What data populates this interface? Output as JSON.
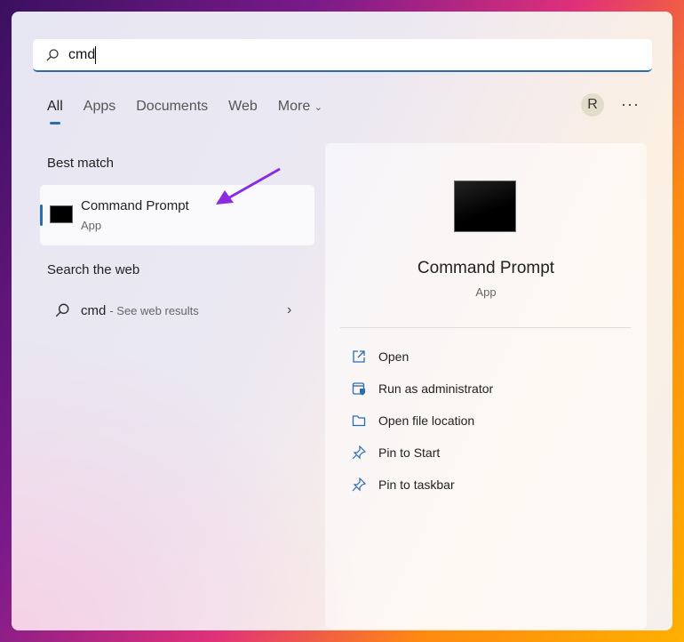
{
  "search": {
    "value": "cmd"
  },
  "tabs": [
    {
      "label": "All"
    },
    {
      "label": "Apps"
    },
    {
      "label": "Documents"
    },
    {
      "label": "Web"
    },
    {
      "label": "More"
    }
  ],
  "user": {
    "initial": "R"
  },
  "more_menu": "···",
  "best_match": {
    "heading": "Best match",
    "title": "Command Prompt",
    "type": "App"
  },
  "web": {
    "heading": "Search the web",
    "query": "cmd",
    "hint": "- See web results"
  },
  "details": {
    "title": "Command Prompt",
    "type": "App",
    "actions": [
      {
        "label": "Open",
        "icon": "open-icon"
      },
      {
        "label": "Run as administrator",
        "icon": "shield-icon"
      },
      {
        "label": "Open file location",
        "icon": "folder-icon"
      },
      {
        "label": "Pin to Start",
        "icon": "pin-icon"
      },
      {
        "label": "Pin to taskbar",
        "icon": "pin-icon"
      }
    ]
  },
  "colors": {
    "accent": "#2a6cb0",
    "arrow": "#8a2be2"
  }
}
